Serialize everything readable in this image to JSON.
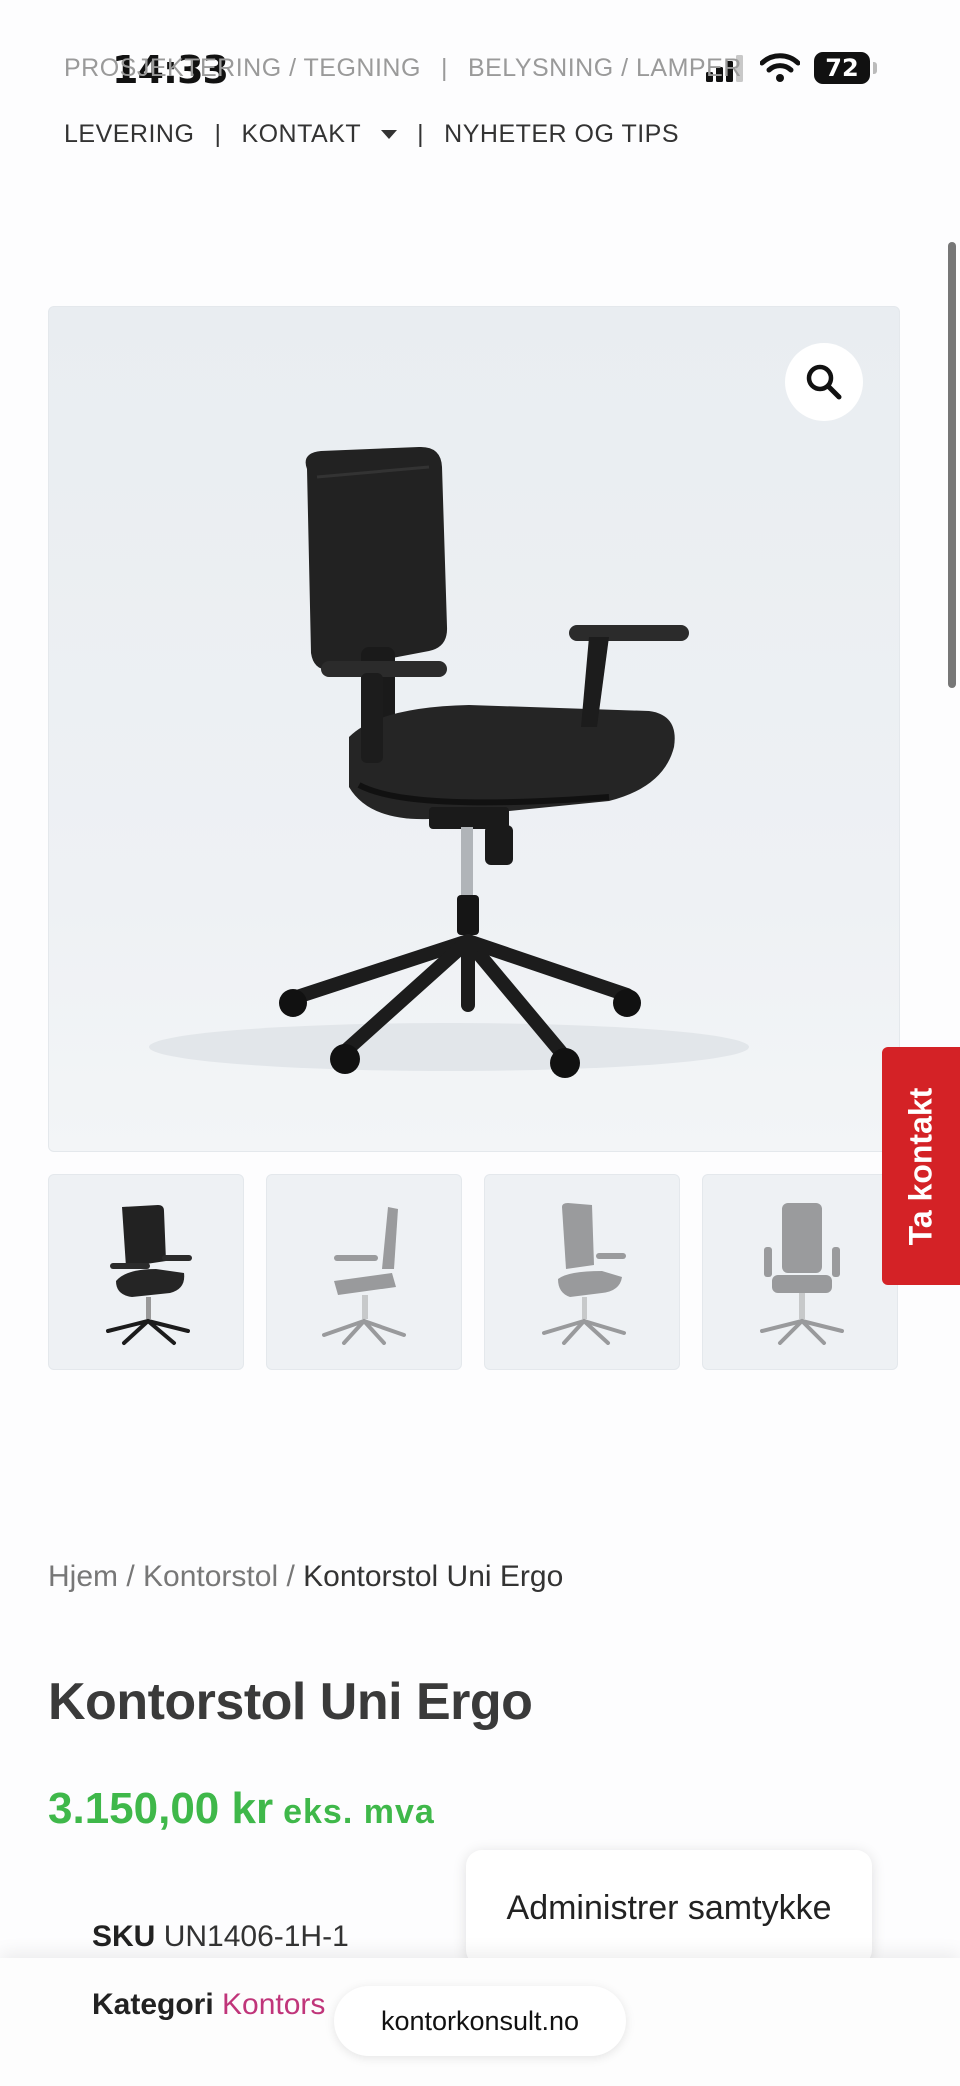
{
  "status": {
    "time": "14:33",
    "battery": "72"
  },
  "nav": {
    "row1": [
      {
        "label": "PROSJEKTERING / TEGNING"
      },
      {
        "label": "BELYSNING / LAMPER"
      }
    ],
    "row2": [
      {
        "label": "LEVERING"
      },
      {
        "label": "KONTAKT"
      },
      {
        "label": "NYHETER OG TIPS"
      }
    ],
    "separator": "|"
  },
  "gallery": {
    "main_alt": "Kontorstol Uni Ergo",
    "thumbnails": [
      "front-angle",
      "side-profile",
      "side-right",
      "back"
    ],
    "active_thumbnail": 0
  },
  "side_tab": {
    "label": "Ta kontakt",
    "color": "#d42226"
  },
  "breadcrumb": {
    "home": "Hjem",
    "sep": " / ",
    "category": "Kontorstol",
    "current": "Kontorstol Uni Ergo"
  },
  "product": {
    "title": "Kontorstol Uni Ergo",
    "price": "3.150,00 kr",
    "price_suffix": "eks. mva",
    "price_color": "#3fb84a",
    "sku_label": "SKU",
    "sku": "UN1406-1H-1",
    "category_label": "Kategori",
    "category": "Kontors"
  },
  "consent": {
    "label": "Administrer samtykke"
  },
  "browser": {
    "url": "kontorkonsult.no"
  }
}
